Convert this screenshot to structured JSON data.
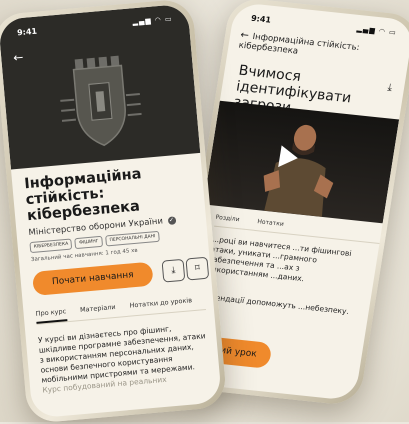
{
  "phone1": {
    "status": {
      "time": "9:41",
      "icons": "▂▄▆ ◠ ▭"
    },
    "back_icon": "arrow-left-icon",
    "course_title": "Інформаційна стійкість: кібербезпека",
    "organization": "Міністерство оборони України",
    "verified_icon": "✓",
    "tags": [
      "КІБЕРБЕЗПЕКА",
      "ФІШИНГ",
      "ПЕРСОНАЛЬНІ ДАНІ"
    ],
    "total_time": "Загальний час навчання: 1 год 45 хв",
    "start_button": "Почати навчання",
    "download_icon": "⤓",
    "bookmark_icon": "⌑",
    "tabs": [
      "Про курс",
      "Матеріали",
      "Нотатки до уроків"
    ],
    "about_text": "У курсі ви дізнаєтесь про фішинг, шкідливе програмне забезпечення, атаки з використанням персональних даних, основи безпечного користування мобільними пристроями та мережами.",
    "about_fade": "Курс побудований на реальних"
  },
  "phone2": {
    "status": {
      "time": "9:41",
      "icons": "▂▄▆ ◠ ▭"
    },
    "header_title": "Інформаційна стійкість: кібербезпека",
    "lesson_title": "Вчимося ідентифікувати загрози",
    "tabs": [
      "Розділи",
      "Нотатки"
    ],
    "body_text": "...році ви навчитеся ...ти фішингові атаки, уникати ...грамного забезпечення та ...ах з використанням ...даних.",
    "body_text2": "...мендації допоможуть ...небезпеку.",
    "next_button": "...ий урок"
  },
  "colors": {
    "accent": "#f08a2c",
    "hero": "#2c2b27",
    "screen": "#f6f2e8"
  }
}
